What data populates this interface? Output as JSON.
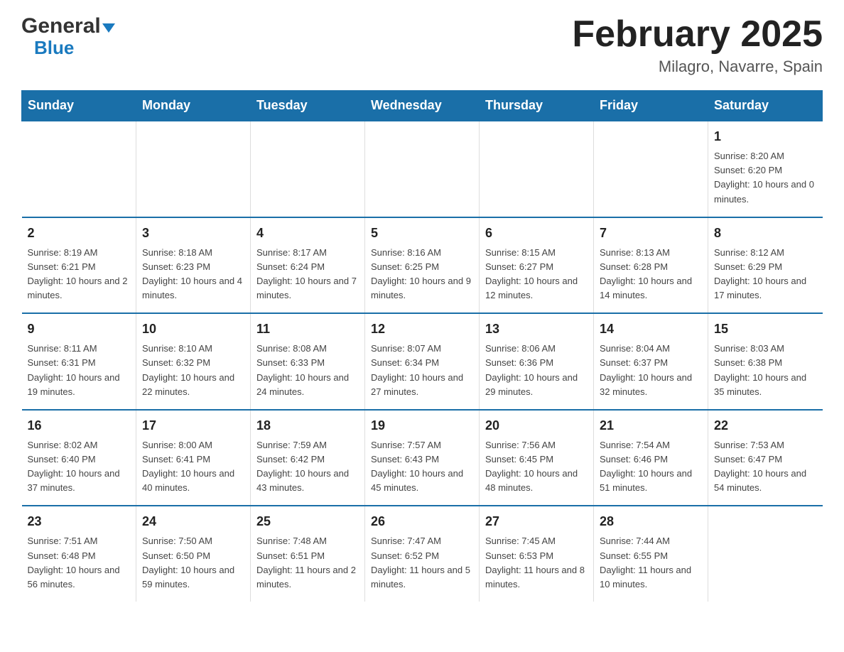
{
  "header": {
    "logo_general": "General",
    "logo_blue": "Blue",
    "month_title": "February 2025",
    "location": "Milagro, Navarre, Spain"
  },
  "days_of_week": [
    "Sunday",
    "Monday",
    "Tuesday",
    "Wednesday",
    "Thursday",
    "Friday",
    "Saturday"
  ],
  "weeks": [
    [
      {
        "day": "",
        "info": ""
      },
      {
        "day": "",
        "info": ""
      },
      {
        "day": "",
        "info": ""
      },
      {
        "day": "",
        "info": ""
      },
      {
        "day": "",
        "info": ""
      },
      {
        "day": "",
        "info": ""
      },
      {
        "day": "1",
        "info": "Sunrise: 8:20 AM\nSunset: 6:20 PM\nDaylight: 10 hours and 0 minutes."
      }
    ],
    [
      {
        "day": "2",
        "info": "Sunrise: 8:19 AM\nSunset: 6:21 PM\nDaylight: 10 hours and 2 minutes."
      },
      {
        "day": "3",
        "info": "Sunrise: 8:18 AM\nSunset: 6:23 PM\nDaylight: 10 hours and 4 minutes."
      },
      {
        "day": "4",
        "info": "Sunrise: 8:17 AM\nSunset: 6:24 PM\nDaylight: 10 hours and 7 minutes."
      },
      {
        "day": "5",
        "info": "Sunrise: 8:16 AM\nSunset: 6:25 PM\nDaylight: 10 hours and 9 minutes."
      },
      {
        "day": "6",
        "info": "Sunrise: 8:15 AM\nSunset: 6:27 PM\nDaylight: 10 hours and 12 minutes."
      },
      {
        "day": "7",
        "info": "Sunrise: 8:13 AM\nSunset: 6:28 PM\nDaylight: 10 hours and 14 minutes."
      },
      {
        "day": "8",
        "info": "Sunrise: 8:12 AM\nSunset: 6:29 PM\nDaylight: 10 hours and 17 minutes."
      }
    ],
    [
      {
        "day": "9",
        "info": "Sunrise: 8:11 AM\nSunset: 6:31 PM\nDaylight: 10 hours and 19 minutes."
      },
      {
        "day": "10",
        "info": "Sunrise: 8:10 AM\nSunset: 6:32 PM\nDaylight: 10 hours and 22 minutes."
      },
      {
        "day": "11",
        "info": "Sunrise: 8:08 AM\nSunset: 6:33 PM\nDaylight: 10 hours and 24 minutes."
      },
      {
        "day": "12",
        "info": "Sunrise: 8:07 AM\nSunset: 6:34 PM\nDaylight: 10 hours and 27 minutes."
      },
      {
        "day": "13",
        "info": "Sunrise: 8:06 AM\nSunset: 6:36 PM\nDaylight: 10 hours and 29 minutes."
      },
      {
        "day": "14",
        "info": "Sunrise: 8:04 AM\nSunset: 6:37 PM\nDaylight: 10 hours and 32 minutes."
      },
      {
        "day": "15",
        "info": "Sunrise: 8:03 AM\nSunset: 6:38 PM\nDaylight: 10 hours and 35 minutes."
      }
    ],
    [
      {
        "day": "16",
        "info": "Sunrise: 8:02 AM\nSunset: 6:40 PM\nDaylight: 10 hours and 37 minutes."
      },
      {
        "day": "17",
        "info": "Sunrise: 8:00 AM\nSunset: 6:41 PM\nDaylight: 10 hours and 40 minutes."
      },
      {
        "day": "18",
        "info": "Sunrise: 7:59 AM\nSunset: 6:42 PM\nDaylight: 10 hours and 43 minutes."
      },
      {
        "day": "19",
        "info": "Sunrise: 7:57 AM\nSunset: 6:43 PM\nDaylight: 10 hours and 45 minutes."
      },
      {
        "day": "20",
        "info": "Sunrise: 7:56 AM\nSunset: 6:45 PM\nDaylight: 10 hours and 48 minutes."
      },
      {
        "day": "21",
        "info": "Sunrise: 7:54 AM\nSunset: 6:46 PM\nDaylight: 10 hours and 51 minutes."
      },
      {
        "day": "22",
        "info": "Sunrise: 7:53 AM\nSunset: 6:47 PM\nDaylight: 10 hours and 54 minutes."
      }
    ],
    [
      {
        "day": "23",
        "info": "Sunrise: 7:51 AM\nSunset: 6:48 PM\nDaylight: 10 hours and 56 minutes."
      },
      {
        "day": "24",
        "info": "Sunrise: 7:50 AM\nSunset: 6:50 PM\nDaylight: 10 hours and 59 minutes."
      },
      {
        "day": "25",
        "info": "Sunrise: 7:48 AM\nSunset: 6:51 PM\nDaylight: 11 hours and 2 minutes."
      },
      {
        "day": "26",
        "info": "Sunrise: 7:47 AM\nSunset: 6:52 PM\nDaylight: 11 hours and 5 minutes."
      },
      {
        "day": "27",
        "info": "Sunrise: 7:45 AM\nSunset: 6:53 PM\nDaylight: 11 hours and 8 minutes."
      },
      {
        "day": "28",
        "info": "Sunrise: 7:44 AM\nSunset: 6:55 PM\nDaylight: 11 hours and 10 minutes."
      },
      {
        "day": "",
        "info": ""
      }
    ]
  ]
}
